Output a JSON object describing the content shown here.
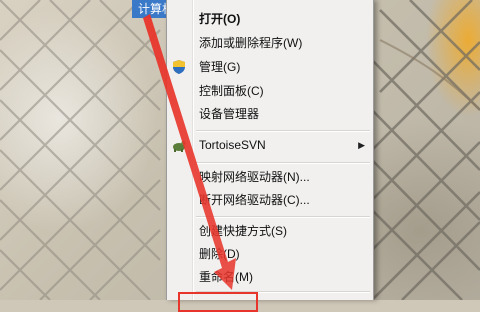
{
  "desktop": {
    "icon_label": "计算机"
  },
  "context_menu": {
    "items": [
      {
        "label": "打开(O)",
        "bold": true
      },
      {
        "label": "添加或删除程序(W)"
      },
      {
        "label": "管理(G)",
        "icon": "uac-shield-icon"
      },
      {
        "label": "控制面板(C)"
      },
      {
        "label": "设备管理器"
      },
      {
        "label": "TortoiseSVN",
        "icon": "tortoisesvn-icon",
        "submenu": true
      },
      {
        "label": "映射网络驱动器(N)..."
      },
      {
        "label": "断开网络驱动器(C)..."
      },
      {
        "label": "创建快捷方式(S)"
      },
      {
        "label": "删除(D)"
      },
      {
        "label": "重命名(M)"
      }
    ],
    "submenu_arrow": "▶"
  },
  "annotation": {
    "color": "#e8352b"
  }
}
